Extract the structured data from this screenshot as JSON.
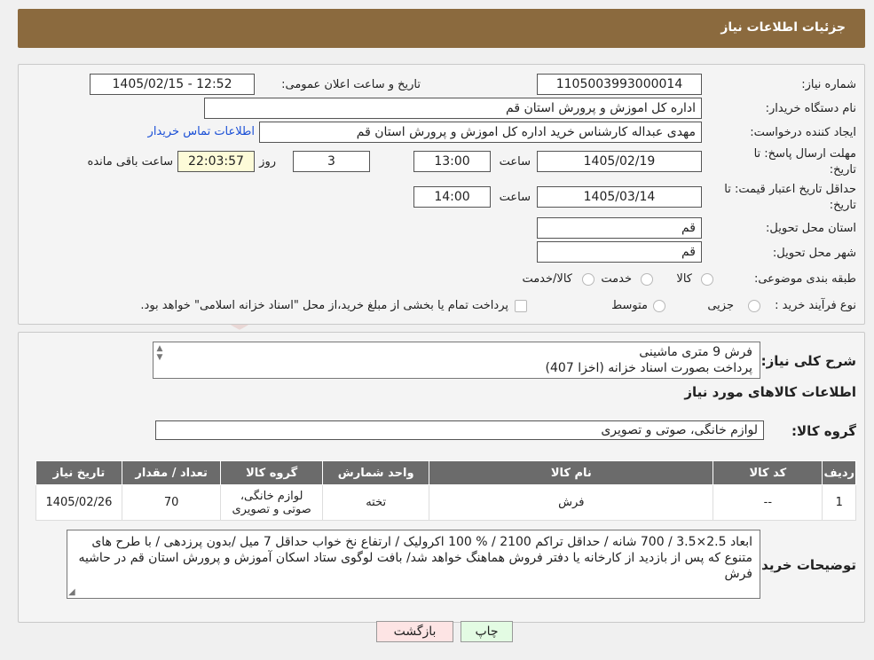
{
  "header": {
    "title": "جزئیات اطلاعات نیاز"
  },
  "form": {
    "need_number_label": "شماره نیاز:",
    "need_number": "1105003993000014",
    "announce_label": "تاریخ و ساعت اعلان عمومی:",
    "announce_value": "1405/02/15 - 12:52",
    "buyer_org_label": "نام دستگاه خریدار:",
    "buyer_org": "اداره کل اموزش و پرورش استان قم",
    "creator_label": "ایجاد کننده درخواست:",
    "creator": "مهدی عبداله کارشناس خرید اداره کل اموزش و پرورش استان قم",
    "contact_link": "اطلاعات تماس خریدار",
    "deadline_label_1": "مهلت ارسال پاسخ: تا",
    "deadline_label_2": "تاریخ:",
    "deadline_date": "1405/02/19",
    "time_word": "ساعت",
    "deadline_time": "13:00",
    "days_value": "3",
    "days_word": "روز و",
    "remaining_time": "22:03:57",
    "remaining_word": "ساعت باقی مانده",
    "validity_label_1": "حداقل تاریخ اعتبار قیمت: تا",
    "validity_label_2": "تاریخ:",
    "validity_date": "1405/03/14",
    "validity_time": "14:00",
    "province_label": "استان محل تحویل:",
    "province": "قم",
    "city_label": "شهر محل تحویل:",
    "city": "قم",
    "category_label": "طبقه بندی موضوعی:",
    "category_options": [
      "کالا",
      "خدمت",
      "کالا/خدمت"
    ],
    "process_label": "نوع فرآیند خرید :",
    "process_options": [
      "جزیی",
      "متوسط"
    ],
    "process_note": "پرداخت تمام یا بخشی از مبلغ خرید،از محل \"اسناد خزانه اسلامی\" خواهد بود."
  },
  "details": {
    "summary_label": "شرح کلی نیاز:",
    "summary_line1": "فرش 9 متری ماشینی",
    "summary_line2": "پرداخت بصورت اسناد خزانه (اخزا 407)",
    "goods_info_title": "اطلاعات کالاهای مورد نیاز",
    "goods_group_label": "گروه کالا:",
    "goods_group": "لوازم خانگی، صوتی و تصویری",
    "table_headers": [
      "ردیف",
      "کد کالا",
      "نام کالا",
      "واحد شمارش",
      "گروه کالا",
      "تعداد / مقدار",
      "تاریخ نیاز"
    ],
    "rows": [
      {
        "row": "1",
        "code": "--",
        "name": "فرش",
        "unit": "تخته",
        "group": "لوازم خانگی، صوتی و تصویری",
        "qty": "70",
        "date": "1405/02/26"
      }
    ],
    "buyer_notes_label": "توضیحات خریدار:",
    "buyer_notes": "ابعاد 2.5×3.5 / 700 شانه / حداقل تراکم 2100 / % 100 اکرولیک / ارتفاع نخ خواب حداقل 7 میل /بدون پرزدهی / با طرح های متنوع که پس از بازدید از کارخانه یا دفتر فروش هماهنگ خواهد شد/ بافت لوگوی ستاد اسکان آموزش و پرورش استان قم در حاشیه فرش"
  },
  "buttons": {
    "print": "چاپ",
    "back": "بازگشت"
  },
  "colors": {
    "header_bg": "#8b6a3e",
    "print_bg": "#e3fbe3",
    "back_bg": "#fde4e4",
    "link": "#1a4fd6"
  }
}
